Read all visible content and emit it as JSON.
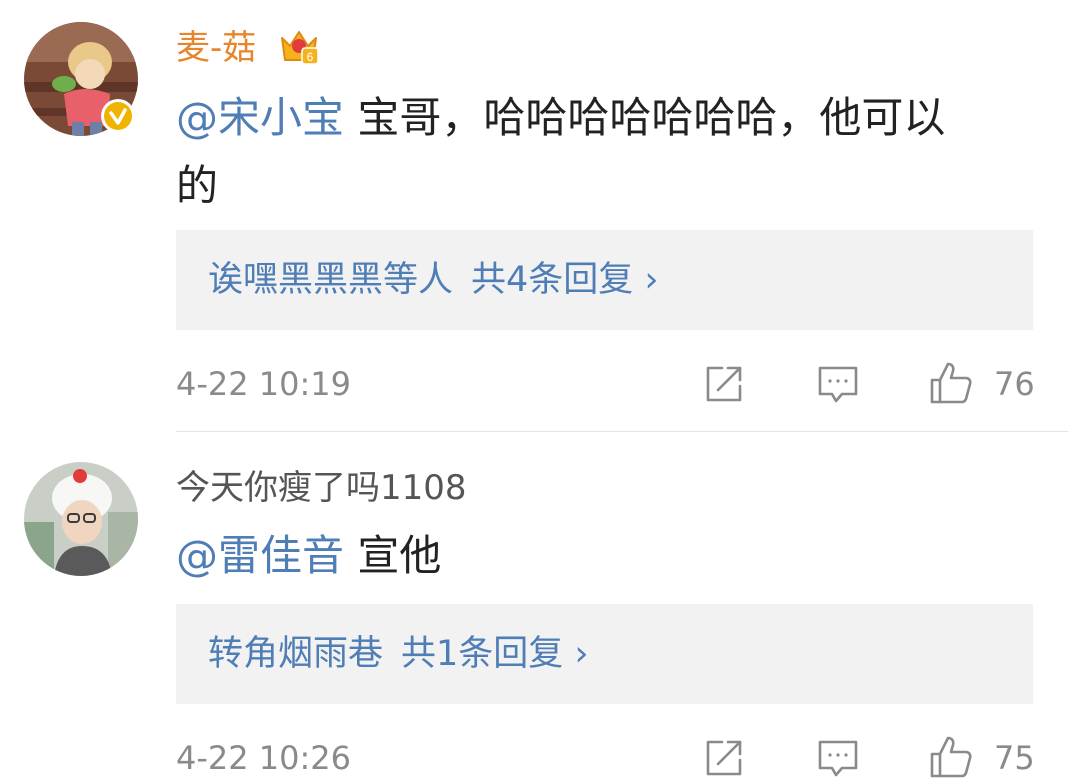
{
  "comments": [
    {
      "username": "麦-菇",
      "mention": "@宋小宝",
      "text_line1": " 宝哥，哈哈哈哈哈哈哈，他可以",
      "text_line2": "的",
      "replies_names": "诶嘿黑黑黑等人",
      "replies_count": "共4条回复",
      "replies_arrow": "›",
      "time": "4-22 10:19",
      "likes": "76",
      "verified": true,
      "vip_level": "6"
    },
    {
      "username": "今天你瘦了吗1108",
      "mention": "@雷佳音",
      "text": " 宣他",
      "replies_names": "转角烟雨巷",
      "replies_count": "共1条回复",
      "replies_arrow": "›",
      "time": "4-22 10:26",
      "likes": "75"
    }
  ],
  "icons": {
    "share": "share-icon",
    "comment": "comment-icon",
    "like": "thumbs-up-icon",
    "crown": "crown-badge-icon",
    "verified": "verified-badge-icon"
  },
  "colors": {
    "link": "#4f7db5",
    "vip_name": "#e8852a",
    "muted": "#8a8a8a",
    "reply_bg": "#f2f2f2"
  }
}
